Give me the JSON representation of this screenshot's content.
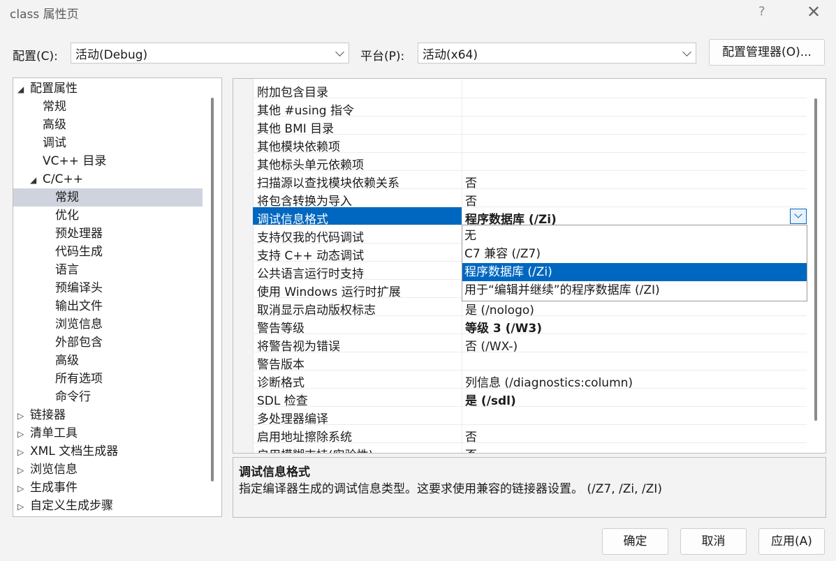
{
  "window": {
    "title": "class 属性页",
    "help_label": "?",
    "close_label": "✕"
  },
  "config": {
    "label": "配置(C):",
    "value": "活动(Debug)"
  },
  "platform": {
    "label": "平台(P):",
    "value": "活动(x64)"
  },
  "config_manager_label": "配置管理器(O)...",
  "tree": {
    "expanded_glyph": "◢",
    "collapsed_glyph": "▷",
    "root": "配置属性",
    "general": [
      "常规",
      "高级",
      "调试",
      "VC++ 目录"
    ],
    "cpp": "C/C++",
    "cpp_children": [
      "常规",
      "优化",
      "预处理器",
      "代码生成",
      "语言",
      "预编译头",
      "输出文件",
      "浏览信息",
      "外部包含",
      "高级",
      "所有选项",
      "命令行"
    ],
    "collapsed": [
      "链接器",
      "清单工具",
      "XML 文档生成器",
      "浏览信息",
      "生成事件",
      "自定义生成步骤"
    ]
  },
  "properties": [
    {
      "name": "附加包含目录",
      "value": ""
    },
    {
      "name": "其他 #using 指令",
      "value": ""
    },
    {
      "name": "其他 BMI 目录",
      "value": ""
    },
    {
      "name": "其他模块依赖项",
      "value": ""
    },
    {
      "name": "其他标头单元依赖项",
      "value": ""
    },
    {
      "name": "扫描源以查找模块依赖关系",
      "value": "否"
    },
    {
      "name": "将包含转换为导入",
      "value": "否"
    },
    {
      "name": "调试信息格式",
      "value": "程序数据库 (/Zi)",
      "bold": true,
      "selected": true
    },
    {
      "name": "支持仅我的代码调试",
      "value": ""
    },
    {
      "name": "支持 C++ 动态调试",
      "value": ""
    },
    {
      "name": "公共语言运行时支持",
      "value": ""
    },
    {
      "name": "使用 Windows 运行时扩展",
      "value": ""
    },
    {
      "name": "取消显示启动版权标志",
      "value": "是 (/nologo)"
    },
    {
      "name": "警告等级",
      "value": "等级 3 (/W3)",
      "bold": true
    },
    {
      "name": "将警告视为错误",
      "value": "否 (/WX-)"
    },
    {
      "name": "警告版本",
      "value": ""
    },
    {
      "name": "诊断格式",
      "value": "列信息 (/diagnostics:column)"
    },
    {
      "name": "SDL 检查",
      "value": "是 (/sdl)",
      "bold": true
    },
    {
      "name": "多处理器编译",
      "value": ""
    },
    {
      "name": "启用地址擦除系统",
      "value": "否"
    },
    {
      "name": "启用模糊支持(实验性)",
      "value": "否"
    }
  ],
  "dropdown": {
    "options": [
      "无",
      "C7 兼容 (/Z7)",
      "程序数据库 (/Zi)",
      "用于“编辑并继续”的程序数据库 (/ZI)"
    ],
    "selected_index": 2
  },
  "description": {
    "title": "调试信息格式",
    "text": "指定编译器生成的调试信息类型。这要求使用兼容的链接器设置。  (/Z7, /Zi, /ZI)"
  },
  "buttons": {
    "ok": "确定",
    "cancel": "取消",
    "apply": "应用(A)"
  },
  "colors": {
    "selection": "#0067c0",
    "tree_selection": "#cfd3de",
    "background": "#f3f3f3"
  }
}
